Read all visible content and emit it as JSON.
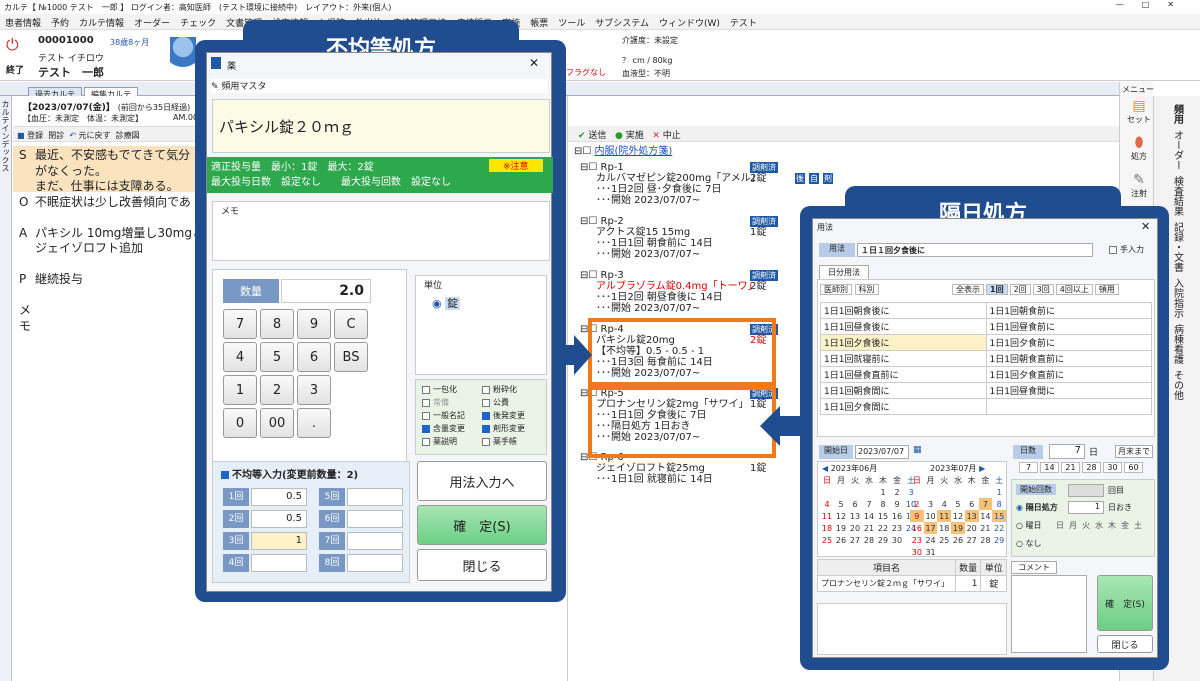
{
  "titlebar": {
    "text": "カルテ【 №1000 テスト　一郎 】 ログイン者：高知医師　(テスト環境に接続中)　レイアウト：外来(個人)",
    "controls": [
      "—",
      "□",
      "✕"
    ]
  },
  "menu": [
    "患者情報",
    "予約",
    "カルテ情報",
    "オーダー",
    "チェック",
    "文書管理",
    "検査情報",
    "入退院",
    "外出泊",
    "病棟管理日誌",
    "病棟版示",
    "実施",
    "帳票",
    "ツール",
    "サブシステム",
    "ウィンドウ(W)",
    "テスト"
  ],
  "patient": {
    "id": "00001000",
    "kana": "テスト イチロウ",
    "name": "テスト　一郎",
    "age": "38歳8ヶ月",
    "end": "終了",
    "nursing": "介護度：未設定",
    "body": "？ cm / 80kg",
    "blood": "血液型：不明",
    "flag": "フラグなし"
  },
  "tabs": [
    "過去カルテ",
    "編集カルテ"
  ],
  "karte": {
    "date": "【2023/07/07(金)】",
    "period": "(前回から35日経過)",
    "vitals": "【血圧：未測定　体温：未測定】",
    "time": "AM.0001",
    "toolbar": [
      "登録",
      "閉診",
      "元に戻す",
      "診療図"
    ],
    "soap": [
      {
        "tag": "S",
        "text": "最近、不安感もでてきて気分"
      },
      {
        "tag": "",
        "text": "がなくった。"
      },
      {
        "tag": "",
        "text": "まだ、仕事には支障ある。"
      },
      {
        "tag": "O",
        "text": "不眠症状は少し改善傾向であ"
      },
      {
        "tag": "",
        "text": ""
      },
      {
        "tag": "A",
        "text": "パキシル 10mg増量し30mgと"
      },
      {
        "tag": "",
        "text": "ジェイゾロフト追加"
      },
      {
        "tag": "",
        "text": ""
      },
      {
        "tag": "P",
        "text": "継続投与"
      },
      {
        "tag": "",
        "text": ""
      },
      {
        "tag": "メ",
        "text": ""
      },
      {
        "tag": "モ",
        "text": ""
      }
    ],
    "sidevert": "カルテインデックス"
  },
  "orders": {
    "toolbar": [
      "送信",
      "実施",
      "中止"
    ],
    "root": "内服(院外処方箋)",
    "rps": [
      {
        "rp": "Rp-1",
        "badge": "調剤済",
        "lines": [
          "カルバマゼピン錠200mg「アメル」",
          "･･･1日2回 昼･夕食後に 7日",
          "･･･開始 2023/07/07~"
        ],
        "qty": "2錠",
        "tags": [
          "後",
          "自",
          "剤"
        ]
      },
      {
        "rp": "Rp-2",
        "badge": "調剤済",
        "lines": [
          "アクトス錠15 15mg",
          "･･･1日1回 朝食前に 14日",
          "･･･開始 2023/07/07~"
        ],
        "qty": "1錠",
        "tags": []
      },
      {
        "rp": "Rp-3",
        "badge": "調剤済",
        "lines": [
          "アルプラゾラム錠0.4mg「トーワ」",
          "･･･1日2回 朝昼食後に 14日",
          "･･･開始 2023/07/07~"
        ],
        "qty": "2錠",
        "tags": []
      },
      {
        "rp": "Rp-4",
        "badge": "調剤済",
        "lines": [
          "パキシル錠20mg",
          "【不均等】0.5 - 0.5 - 1",
          "･･･1日3回 毎食前に 14日",
          "･･･開始 2023/07/07~"
        ],
        "qty": "2錠",
        "tags": []
      },
      {
        "rp": "Rp-5",
        "badge": "調剤済",
        "lines": [
          "プロナンセリン錠2mg「サワイ」",
          "･･･1日1回 夕食後に 7日",
          "･･･隔日処方 1日おき",
          "･･･開始 2023/07/07~"
        ],
        "qty": "1錠",
        "tags": []
      },
      {
        "rp": "Rp-6",
        "badge": "",
        "lines": [
          "ジェイゾロフト錠25mg",
          "･･･1日1回 就寝前に 14日"
        ],
        "qty": "1錠",
        "tags": []
      }
    ]
  },
  "dialog1": {
    "label": "不均等処方",
    "title": "薬",
    "tab": "頻用マスタ",
    "drug": "パキシル錠２０ｍｇ",
    "warn": "※注意",
    "dose1": "適正投与量　最小：1錠　最大：2錠",
    "dose2": "最大投与日数　設定なし　　最大投与回数　設定なし",
    "memo": "メモ",
    "qty_label": "数量",
    "qty": "2.0",
    "keys": [
      "7",
      "8",
      "9",
      "C",
      "4",
      "5",
      "6",
      "BS",
      "1",
      "2",
      "3",
      "",
      "0",
      "00",
      ".",
      ""
    ],
    "unit_label": "単位",
    "unit": "錠",
    "checks": [
      {
        "l": "一包化",
        "on": false
      },
      {
        "l": "粉砕化",
        "on": false
      },
      {
        "l": "常備",
        "on": false
      },
      {
        "l": "公費",
        "on": false
      },
      {
        "l": "一般名記",
        "on": false
      },
      {
        "l": "後発変更",
        "on": true
      },
      {
        "l": "含量変更",
        "on": true
      },
      {
        "l": "剤形変更",
        "on": true
      },
      {
        "l": "薬説明",
        "on": false
      },
      {
        "l": "薬手帳",
        "on": false
      }
    ],
    "uneven": "不均等入力(変更前数量：2)",
    "times": [
      {
        "l": "1回",
        "v": "0.5"
      },
      {
        "l": "5回",
        "v": ""
      },
      {
        "l": "2回",
        "v": "0.5"
      },
      {
        "l": "6回",
        "v": ""
      },
      {
        "l": "3回",
        "v": "1"
      },
      {
        "l": "7回",
        "v": ""
      },
      {
        "l": "4回",
        "v": ""
      },
      {
        "l": "8回",
        "v": ""
      }
    ],
    "btn_usage": "用法入力へ",
    "btn_ok": "確　定(S)",
    "btn_close": "閉じる"
  },
  "dialog2": {
    "label": "隔日処方",
    "title": "用法",
    "usage_btn": "用法",
    "usage": "１日１回夕食後に",
    "manual": "手入力",
    "tab": "日分用法",
    "filters": [
      "医師別",
      "科別"
    ],
    "counts": [
      "全表示",
      "1回",
      "2回",
      "3回",
      "4回以上",
      "頓用"
    ],
    "list": [
      [
        "1日1回朝食後に",
        "1日1回朝食前に"
      ],
      [
        "1日1回昼食後に",
        "1日1回昼食前に"
      ],
      [
        "1日1回夕食後に",
        "1日1回夕食前に"
      ],
      [
        "1日1回就寝前に",
        "1日1回朝食直前に"
      ],
      [
        "1日1回昼食直前に",
        "1日1回夕食直前に"
      ],
      [
        "1日1回朝食間に",
        "1日1回昼食間に"
      ],
      [
        "1日1回夕食間に",
        ""
      ]
    ],
    "start_label": "開始日",
    "start": "2023/07/07",
    "days_label": "日数",
    "days": "7",
    "day_unit": "日",
    "monthend": "月末まで",
    "day_btns": [
      "7",
      "14",
      "21",
      "28",
      "30",
      "60"
    ],
    "cal1": "2023年06月",
    "cal2": "2023年07月",
    "wd": [
      "日",
      "月",
      "火",
      "水",
      "木",
      "金",
      "土"
    ],
    "jun": [
      [
        "",
        "",
        "",
        "",
        "1",
        "2",
        "3"
      ],
      [
        "4",
        "5",
        "6",
        "7",
        "8",
        "9",
        "10"
      ],
      [
        "11",
        "12",
        "13",
        "14",
        "15",
        "16",
        "17"
      ],
      [
        "18",
        "19",
        "20",
        "21",
        "22",
        "23",
        "24"
      ],
      [
        "25",
        "26",
        "27",
        "28",
        "29",
        "30",
        ""
      ]
    ],
    "jul": [
      [
        "",
        "",
        "",
        "",
        "",
        "",
        "1"
      ],
      [
        "2",
        "3",
        "4",
        "5",
        "6",
        "7",
        "8"
      ],
      [
        "9",
        "10",
        "11",
        "12",
        "13",
        "14",
        "15"
      ],
      [
        "16",
        "17",
        "18",
        "19",
        "20",
        "21",
        "22"
      ],
      [
        "23",
        "24",
        "25",
        "26",
        "27",
        "28",
        "29"
      ],
      [
        "30",
        "31",
        "",
        "",
        "",
        "",
        ""
      ]
    ],
    "times_label": "開始回数",
    "times_unit": "回目",
    "kakujitsu": "隔日処方",
    "kakujitsu_val": "1",
    "okidays": "日おき",
    "youbi": "曜日",
    "youbi_days": [
      "日",
      "月",
      "火",
      "水",
      "木",
      "金",
      "土"
    ],
    "nashi": "なし",
    "table_head": [
      "項目名",
      "数量",
      "単位"
    ],
    "table_row": [
      "プロナンセリン錠２ｍｇ「サワイ」",
      "1",
      "錠"
    ],
    "comment": "コメント",
    "ok": "確　定(S)",
    "close": "閉じる"
  },
  "rightbar": {
    "top": "メニュー",
    "items": [
      "セット",
      "処方",
      "注射"
    ],
    "vert": [
      "頻用",
      "オーダー",
      "検査結果",
      "記録・文書",
      "入院指示",
      "病棟看護",
      "その他"
    ]
  }
}
